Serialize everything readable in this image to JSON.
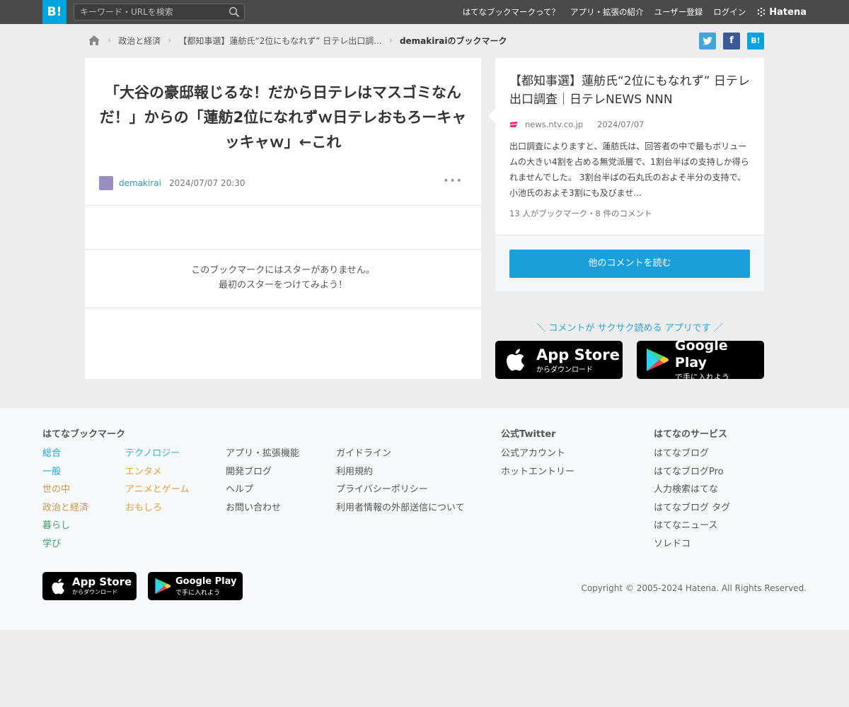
{
  "header": {
    "logo": "B!",
    "search_placeholder": "キーワード・URLを検索",
    "nav": [
      "はてなブックマークって？",
      "アプリ・拡張の紹介",
      "ユーザー登録",
      "ログイン"
    ],
    "hatena": "Hatena"
  },
  "breadcrumb": {
    "items": [
      "政治と経済",
      "【都知事選】蓮舫氏“2位にもなれず” 日テレ出口調...",
      "demakiraiのブックマーク"
    ]
  },
  "share": {
    "twitter": "t",
    "facebook": "f",
    "hatena": "B!"
  },
  "bookmark": {
    "comment": "「大谷の豪邸報じるな！だから日テレはマスゴミなんだ！」からの「蓮舫2位になれずｗ日テレおもろーキャッキャｗ」←これ",
    "user": "demakirai",
    "date": "2024/07/07 20:30",
    "more": "•••",
    "no_star_line1": "このブックマークにはスターがありません。",
    "no_star_line2": "最初のスターをつけてみよう！"
  },
  "entry": {
    "title": "【都知事選】蓮舫氏“2位にもなれず” 日テレ出口調査｜日テレNEWS NNN",
    "source": "news.ntv.co.jp",
    "date": "2024/07/07",
    "summary": "出口調査によりますと、蓮舫氏は、回答者の中で最もボリュームの大きい4割を占める無党派層で、1割台半ばの支持しか得られませんでした。 3割台半ばの石丸氏のおよそ半分の支持で、小池氏のおよそ3割にも及びませ...",
    "counts": "13 人がブックマーク・8 件のコメント",
    "read_button": "他のコメントを読む"
  },
  "promo": {
    "text": "＼ コメントが サクサク読める アプリです ／",
    "appstore_big": "App Store",
    "appstore_small": "からダウンロード",
    "googleplay_big": "Google Play",
    "googleplay_small": "で手に入れよう"
  },
  "footer": {
    "bookmark_heading": "はてなブックマーク",
    "categories_col1": [
      "総合",
      "一般",
      "世の中",
      "政治と経済",
      "暮らし",
      "学び"
    ],
    "categories_col2": [
      "テクノロジー",
      "エンタメ",
      "アニメとゲーム",
      "おもしろ"
    ],
    "col3": [
      "アプリ・拡張機能",
      "開発ブログ",
      "ヘルプ",
      "お問い合わせ"
    ],
    "col4": [
      "ガイドライン",
      "利用規約",
      "プライバシーポリシー",
      "利用者情報の外部送信について"
    ],
    "twitter_heading": "公式Twitter",
    "twitter_links": [
      "公式アカウント",
      "ホットエントリー"
    ],
    "services_heading": "はてなのサービス",
    "services": [
      "はてなブログ",
      "はてなブログPro",
      "人力検索はてな",
      "はてなブログ タグ",
      "はてなニュース",
      "ソレドコ"
    ],
    "copyright": "Copyright © 2005-2024 Hatena. All Rights Reserved."
  },
  "colors": {
    "accent": "#00a4de",
    "col1": [
      "#1a9fd8",
      "#1a9fd8",
      "#c8974b",
      "#c8974b",
      "#3aa06a",
      "#3aa06a"
    ],
    "col2": [
      "#1fb8d8",
      "#e8a02e",
      "#e8a02e",
      "#e8a02e"
    ]
  }
}
